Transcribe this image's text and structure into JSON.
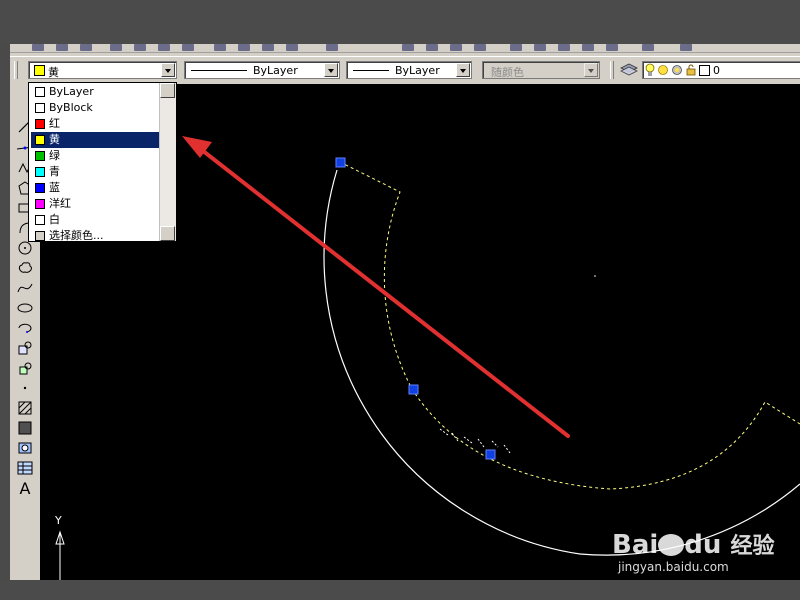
{
  "toolbar": {
    "color_combo": {
      "value": "黄",
      "swatch": "#ffff00"
    },
    "linetype_combo": {
      "value": "ByLayer"
    },
    "lineweight_combo": {
      "value": "ByLayer"
    },
    "plotstyle_combo": {
      "value": "随颜色"
    },
    "layer_combo": {
      "value": "0"
    }
  },
  "color_dropdown": {
    "items": [
      {
        "label": "ByLayer",
        "swatch": "#ffffff"
      },
      {
        "label": "ByBlock",
        "swatch": "#ffffff"
      },
      {
        "label": "红",
        "swatch": "#ff0000"
      },
      {
        "label": "黄",
        "swatch": "#ffff00",
        "selected": true
      },
      {
        "label": "绿",
        "swatch": "#00c000"
      },
      {
        "label": "青",
        "swatch": "#00ffff"
      },
      {
        "label": "蓝",
        "swatch": "#0000ff"
      },
      {
        "label": "洋红",
        "swatch": "#ff00ff"
      },
      {
        "label": "白",
        "swatch": "#ffffff"
      },
      {
        "label": "选择颜色...",
        "swatch": "#d4d0c8"
      }
    ]
  },
  "ucs_icon": {
    "y_label": "Y"
  },
  "watermark": {
    "brand": "Bai",
    "brand2": "du",
    "suffix": "经验",
    "url": "jingyan.baidu.com"
  },
  "colors": {
    "canvas": "#000000",
    "arrow": "#e03030",
    "grip": "#1040e0",
    "selection": "#0a246a"
  }
}
